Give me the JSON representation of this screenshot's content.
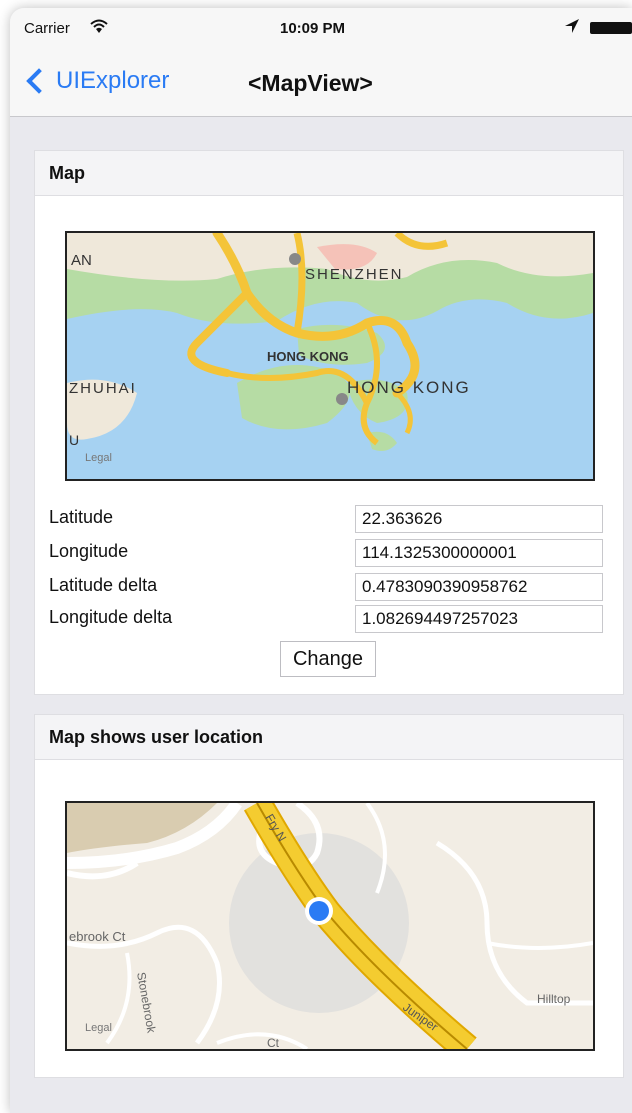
{
  "status": {
    "carrier": "Carrier",
    "wifi_icon": "wifi-icon",
    "time": "10:09 PM",
    "location_icon": "location-arrow-icon",
    "battery_icon": "battery-icon"
  },
  "nav": {
    "back_label": "UIExplorer",
    "title": "<MapView>"
  },
  "map_panel": {
    "header": "Map",
    "map": {
      "labels": [
        "AN",
        "SHENZHEN",
        "HONG KONG",
        "HONG KONG",
        "ZHUHAI",
        "U"
      ],
      "legal": "Legal"
    },
    "fields": [
      {
        "label": "Latitude",
        "value": "22.363626"
      },
      {
        "label": "Longitude",
        "value": "114.1325300000001"
      },
      {
        "label": "Latitude delta",
        "value": "0.4783090390958762"
      },
      {
        "label": "Longitude delta",
        "value": "1.082694497257023"
      }
    ],
    "change_label": "Change"
  },
  "user_location_panel": {
    "header": "Map shows user location",
    "map": {
      "labels": [
        "Fry N",
        "ebrook Ct",
        "Stonebrook",
        "Juniper",
        "Hilltop",
        "Ct"
      ],
      "legal": "Legal"
    }
  },
  "colors": {
    "accent": "#2a7bf4",
    "water": "#a6d2f2",
    "land": "#efe8da",
    "park": "#b6dca4",
    "road": "#f4c438",
    "user_dot": "#2a7bf4"
  }
}
